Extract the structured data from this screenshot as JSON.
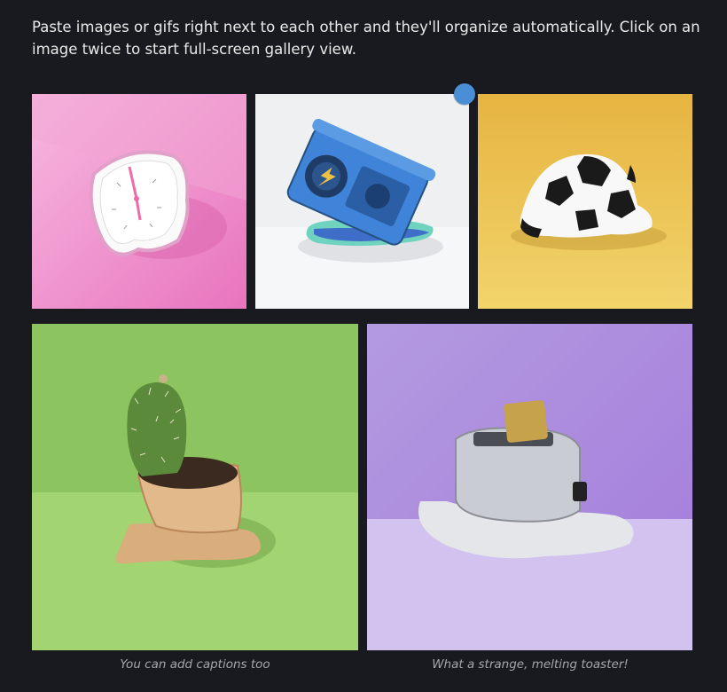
{
  "intro": {
    "text": "Paste images or gifs right next to each other and they'll organize automatically. Click on an image twice to start full-screen gallery view."
  },
  "gallery": {
    "images": [
      {
        "subject": "melting clock",
        "background": "#f0a8d6"
      },
      {
        "subject": "melting boombox",
        "background": "#eef0f2"
      },
      {
        "subject": "melting soccer ball",
        "background": "#f0c84a"
      },
      {
        "subject": "melting cactus pot",
        "background": "#8cc560"
      },
      {
        "subject": "melting toaster",
        "background": "#b28be0"
      }
    ],
    "captions": [
      "You can add captions too",
      "What a strange, melting toaster!"
    ]
  },
  "colors": {
    "background": "#191a1f",
    "text": "#e9e9ea",
    "caption": "#a5a6ab",
    "accent": "#4a8fd6"
  }
}
